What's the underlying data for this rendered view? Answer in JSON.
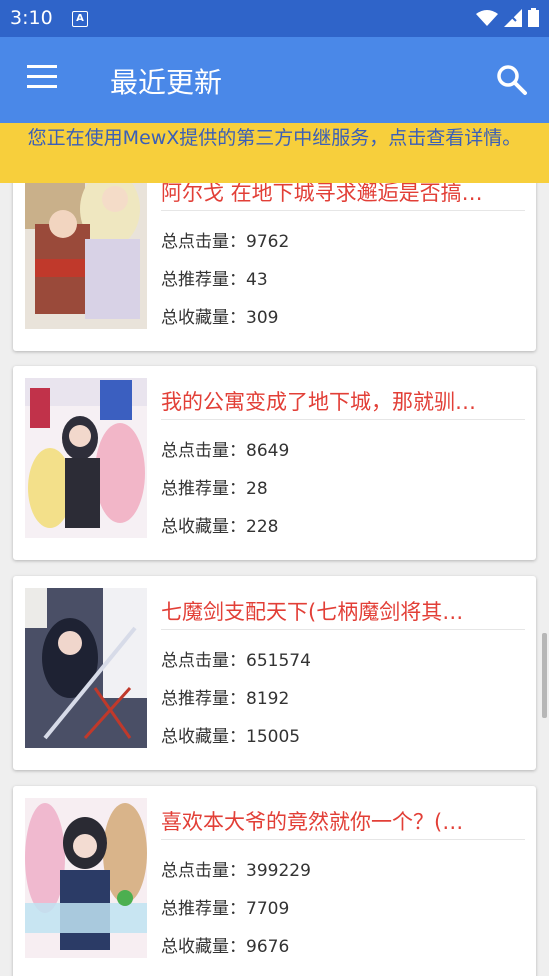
{
  "status": {
    "time": "3:10",
    "a_icon": "A"
  },
  "appbar": {
    "title": "最近更新",
    "menu_icon": "menu-icon",
    "search_icon": "search-icon"
  },
  "notice": {
    "text": "您正在使用MewX提供的第三方中继服务，点击查看详情。"
  },
  "colors": {
    "primary_dark": "#2f64c9",
    "primary": "#4a88e8",
    "notice_bg": "#f7cf3c",
    "title_red": "#e23f37"
  },
  "stat_labels": {
    "clicks": "总点击量：",
    "recommends": "总推荐量：",
    "favorites": "总收藏量："
  },
  "novels": [
    {
      "title": "阿尔戈 在地下城寻求邂逅是否搞…",
      "clicks": "9762",
      "recommends": "43",
      "favorites": "309"
    },
    {
      "title": "我的公寓变成了地下城，那就驯…",
      "clicks": "8649",
      "recommends": "28",
      "favorites": "228"
    },
    {
      "title": "七魔剑支配天下(七柄魔剑将其…",
      "clicks": "651574",
      "recommends": "8192",
      "favorites": "15005"
    },
    {
      "title": "喜欢本大爷的竟然就你一个？(…",
      "clicks": "399229",
      "recommends": "7709",
      "favorites": "9676"
    }
  ]
}
